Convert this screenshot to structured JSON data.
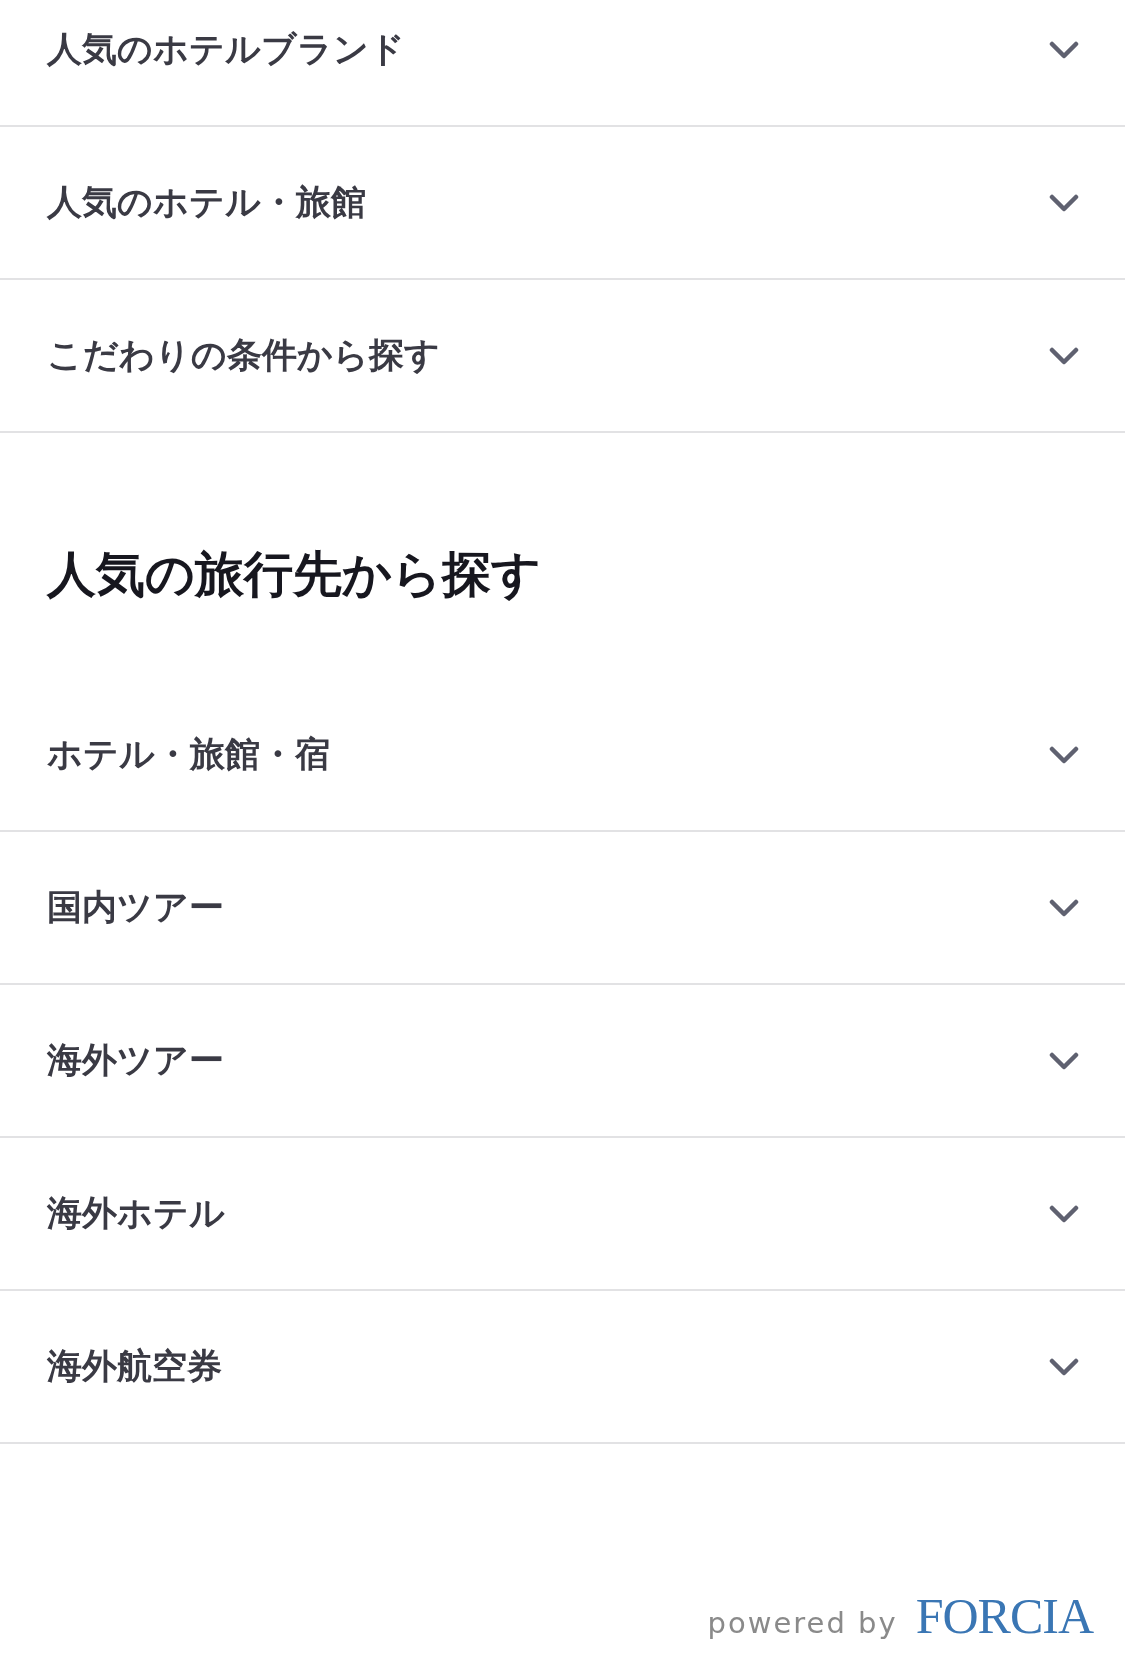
{
  "sections": [
    {
      "items": [
        {
          "label": "人気のホテルブランド",
          "expanded": false
        },
        {
          "label": "人気のホテル・旅館",
          "expanded": false
        },
        {
          "label": "こだわりの条件から探す",
          "expanded": false
        }
      ]
    },
    {
      "heading": "人気の旅行先から探す",
      "items": [
        {
          "label": "ホテル・旅館・宿",
          "expanded": false
        },
        {
          "label": "国内ツアー",
          "expanded": false
        },
        {
          "label": "海外ツアー",
          "expanded": false
        },
        {
          "label": "海外ホテル",
          "expanded": false
        },
        {
          "label": "海外航空券",
          "expanded": false
        }
      ]
    }
  ],
  "footer": {
    "powered_by": "powered by",
    "brand": "FORCIA"
  }
}
